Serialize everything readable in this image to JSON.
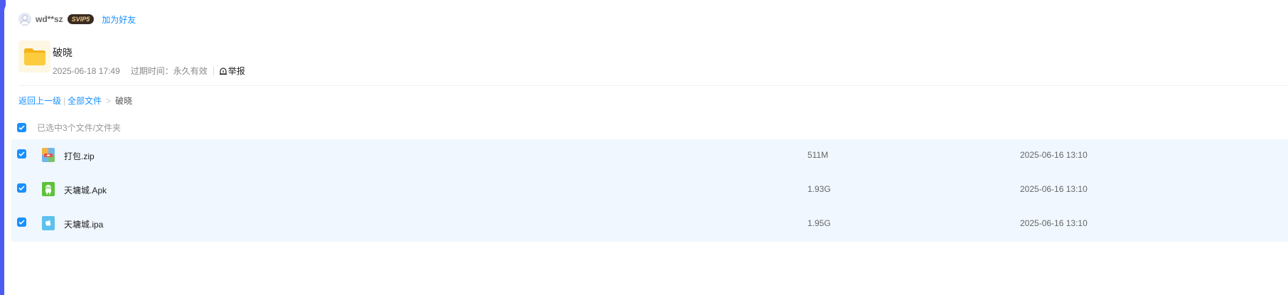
{
  "colors": {
    "accent": "#1890ff",
    "side_bar": "#4d5cf0",
    "row_bg": "#f0f7ff",
    "vip_bg": "#3a2c22",
    "vip_text": "#f0c98a"
  },
  "user": {
    "name": "wd**sz",
    "vip_label": "SVIP5",
    "add_friend": "加为好友",
    "avatar_icon": "user-avatar-icon"
  },
  "share": {
    "folder_icon": "folder-icon",
    "title": "破晓",
    "created": "2025-06-18 17:49",
    "expiry_label": "过期时间：",
    "expiry_value": "永久有效",
    "report_label": "举报",
    "report_icon": "alarm-icon"
  },
  "breadcrumb": {
    "back": "返回上一级",
    "separator_bar": "|",
    "all_files": "全部文件",
    "arrow": ">",
    "current": "破晓"
  },
  "selection": {
    "text": "已选中3个文件/文件夹",
    "checked": true
  },
  "files": [
    {
      "name": "打包.zip",
      "size": "511M",
      "date": "2025-06-16 13:10",
      "icon": "zip-archive-icon",
      "checked": true
    },
    {
      "name": "天墉城.Apk",
      "size": "1.93G",
      "date": "2025-06-16 13:10",
      "icon": "android-apk-icon",
      "checked": true
    },
    {
      "name": "天墉城.ipa",
      "size": "1.95G",
      "date": "2025-06-16 13:10",
      "icon": "apple-ipa-icon",
      "checked": true
    }
  ]
}
